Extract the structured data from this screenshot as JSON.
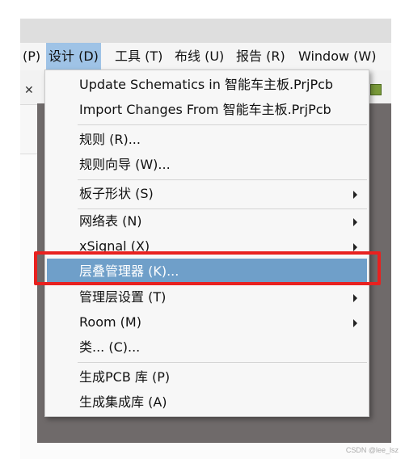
{
  "menubar": {
    "items": [
      {
        "label": "(P)"
      },
      {
        "label": "设计 (D)"
      },
      {
        "label": "工具 (T)"
      },
      {
        "label": "布线 (U)"
      },
      {
        "label": "报告 (R)"
      },
      {
        "label": "Window (W)"
      }
    ]
  },
  "design_menu": {
    "items": [
      {
        "label": "Update Schematics in 智能车主板.PrjPcb",
        "submenu": false
      },
      {
        "label": "Import Changes From 智能车主板.PrjPcb",
        "submenu": false
      },
      {
        "label": "规则 (R)...",
        "submenu": false
      },
      {
        "label": "规则向导 (W)...",
        "submenu": false
      },
      {
        "label": "板子形状 (S)",
        "submenu": true
      },
      {
        "label": "网络表 (N)",
        "submenu": true
      },
      {
        "label": "xSignal (X)",
        "submenu": true
      },
      {
        "label": "层叠管理器 (K)...",
        "submenu": false,
        "highlighted": true
      },
      {
        "label": "管理层设置 (T)",
        "submenu": true
      },
      {
        "label": "Room (M)",
        "submenu": true
      },
      {
        "label": "类... (C)...",
        "submenu": false
      },
      {
        "label": "生成PCB 库 (P)",
        "submenu": false
      },
      {
        "label": "生成集成库 (A)",
        "submenu": false
      }
    ]
  },
  "watermark": "CSDN @lee_lsz",
  "colors": {
    "highlight": "#6f9fc9",
    "annotation_box": "#e8211f",
    "workspace": "#6f6a6a"
  }
}
